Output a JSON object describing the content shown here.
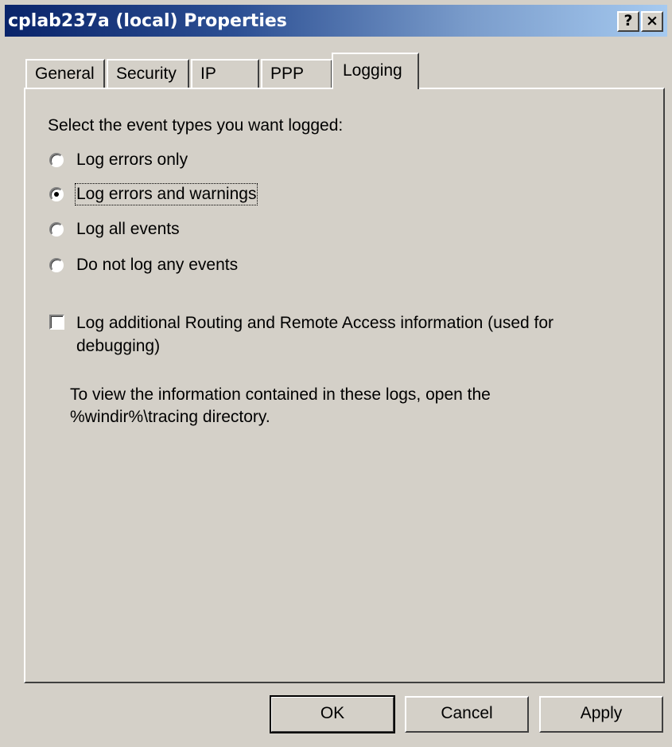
{
  "window": {
    "title": "cplab237a (local) Properties",
    "help_label": "?",
    "close_label": "×"
  },
  "tabs": [
    {
      "label": "General",
      "active": false
    },
    {
      "label": "Security",
      "active": false
    },
    {
      "label": "IP",
      "active": false
    },
    {
      "label": "PPP",
      "active": false
    },
    {
      "label": "Logging",
      "active": true
    }
  ],
  "logging": {
    "prompt": "Select the event types you want logged:",
    "options": [
      {
        "label": "Log errors only",
        "selected": false
      },
      {
        "label": "Log errors and warnings",
        "selected": true
      },
      {
        "label": "Log all events",
        "selected": false
      },
      {
        "label": "Do not log any events",
        "selected": false
      }
    ],
    "additional": {
      "line1": "Log additional Routing and Remote Access information (used for",
      "line2": "debugging)",
      "checked": false
    },
    "info": {
      "line1": "To view the information contained in these logs, open the",
      "line2": "%windir%\\tracing directory."
    }
  },
  "buttons": {
    "ok": "OK",
    "cancel": "Cancel",
    "apply": "Apply"
  }
}
